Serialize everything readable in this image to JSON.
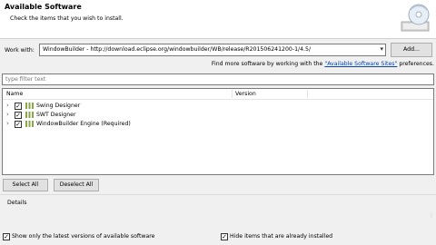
{
  "header": {
    "title": "Available Software",
    "description": "Check the items that you wish to install."
  },
  "work_with": {
    "label": "Work with:",
    "value": "WindowBuilder - http://download.eclipse.org/windowbuilder/WB/release/R201506241200-1/4.5/",
    "add_button": "Add..."
  },
  "find_more": {
    "prefix": "Find more software by working with the ",
    "link": "\"Available Software Sites\"",
    "suffix": " preferences."
  },
  "filter": {
    "placeholder": "type filter text"
  },
  "tree": {
    "columns": [
      "Name",
      "Version"
    ],
    "items": [
      {
        "label": "Swing Designer",
        "checked": true,
        "version": ""
      },
      {
        "label": "SWT Designer",
        "checked": true,
        "version": ""
      },
      {
        "label": "WindowBuilder Engine (Required)",
        "checked": true,
        "version": ""
      }
    ]
  },
  "buttons": {
    "select_all": "Select All",
    "deselect_all": "Deselect All"
  },
  "details": {
    "label": "Details"
  },
  "options": {
    "show_latest": "Show only the latest versions of available software",
    "hide_installed": "Hide items that are already installed"
  },
  "colors": {
    "background": "#f0f0f0",
    "link": "#0645ad",
    "package_icon": "#8aa84a"
  }
}
